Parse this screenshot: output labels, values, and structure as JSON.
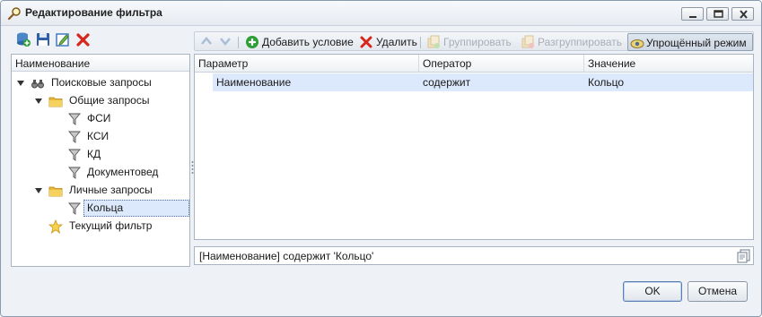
{
  "window": {
    "title": "Редактирование фильтра"
  },
  "tree": {
    "header": "Наименование",
    "items": [
      {
        "label": "Поисковые запросы",
        "icon": "binoculars-icon"
      },
      {
        "label": "Общие запросы",
        "icon": "folder-icon"
      },
      {
        "label": "ФСИ",
        "icon": "filter-icon"
      },
      {
        "label": "КСИ",
        "icon": "filter-icon"
      },
      {
        "label": "КД",
        "icon": "filter-icon"
      },
      {
        "label": "Документовед",
        "icon": "filter-icon"
      },
      {
        "label": "Личные запросы",
        "icon": "folder-icon"
      },
      {
        "label": "Кольца",
        "icon": "filter-icon"
      },
      {
        "label": "Текущий фильтр",
        "icon": "star-icon"
      }
    ]
  },
  "toolbar": {
    "add_condition": "Добавить условие",
    "delete": "Удалить",
    "group": "Группировать",
    "ungroup": "Разгруппировать",
    "simple_mode": "Упрощённый режим"
  },
  "grid": {
    "columns": [
      "Параметр",
      "Оператор",
      "Значение"
    ],
    "rows": [
      [
        "Наименование",
        "содержит",
        "Кольцо"
      ]
    ]
  },
  "expression": "[Наименование] содержит 'Кольцо'",
  "buttons": {
    "ok": "OK",
    "cancel": "Отмена"
  },
  "colors": {
    "selection": "#dce8fb",
    "window_bg": "#eef1f5",
    "delete_red": "#d8261c",
    "add_green": "#2e9e36"
  }
}
